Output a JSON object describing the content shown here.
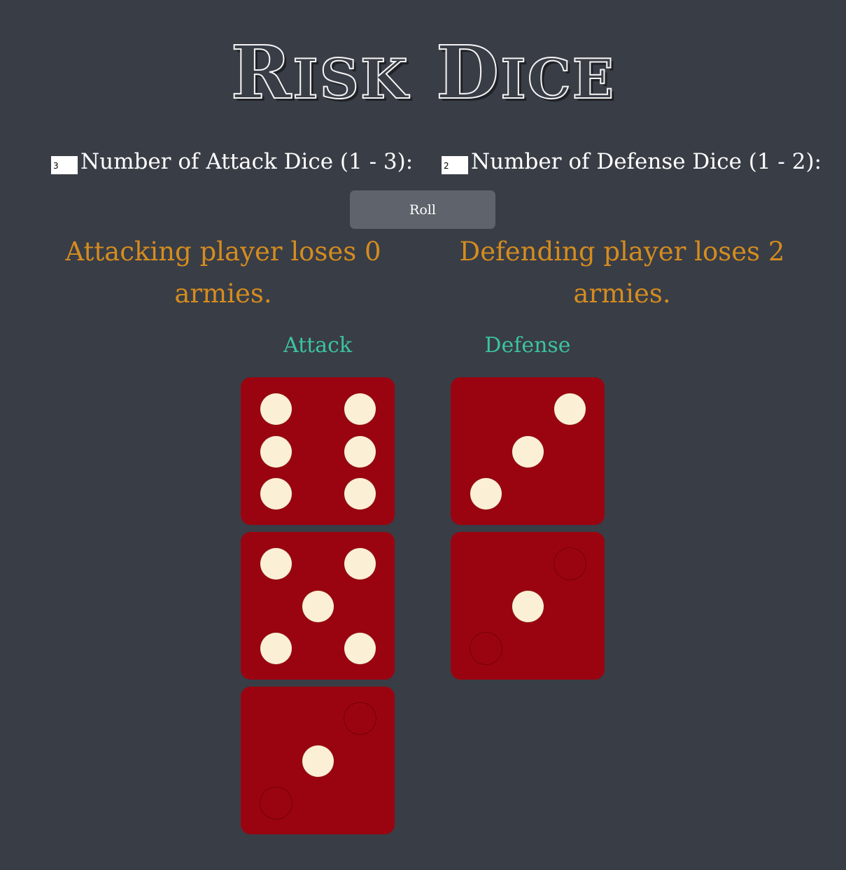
{
  "title": "Risk Dice",
  "controls": {
    "attack_input_value": "3",
    "attack_label": "Number of Attack Dice (1 - 3):",
    "defense_input_value": "2",
    "defense_label": "Number of Defense Dice (1 - 2):",
    "roll_label": "Roll"
  },
  "results": {
    "attack": "Attacking player loses 0 armies.",
    "defense": "Defending player loses 2 armies."
  },
  "columns": {
    "attack_title": "Attack",
    "defense_title": "Defense"
  },
  "dice": {
    "attack": [
      6,
      5,
      1
    ],
    "defense": [
      3,
      1
    ]
  },
  "colors": {
    "background": "#393d46",
    "die": "#9a0410",
    "pip": "#fbefd6",
    "result_text": "#d58c1e",
    "column_title": "#3cc49c",
    "button": "#5f636b"
  }
}
